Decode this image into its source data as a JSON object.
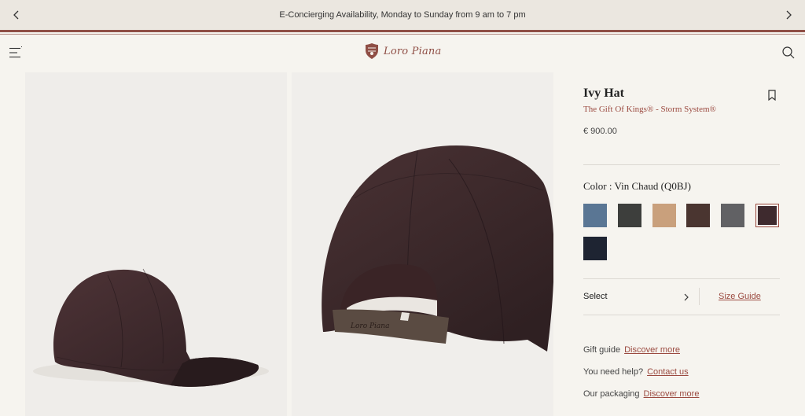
{
  "promo": {
    "text": "E-Concierging Availability, Monday to Sunday from 9 am to 7 pm"
  },
  "header": {
    "logo_text": "Loro Piana"
  },
  "colors": {
    "brand": "#8f4e45",
    "accent_text": "#9b4a40",
    "background": "#f6f4ef",
    "promo_bg": "#ebe7e0"
  },
  "product": {
    "title": "Ivy Hat",
    "subtitle": "The Gift Of Kings® - Storm System®",
    "price": "€ 900.00",
    "color_label": "Color : Vin Chaud (Q0BJ)",
    "swatches": [
      {
        "color": "#5a7694"
      },
      {
        "color": "#3d3e3c"
      },
      {
        "color": "#c9a07c"
      },
      {
        "color": "#4a3530"
      },
      {
        "color": "#616164"
      },
      {
        "color": "#3e2a2e",
        "selected": true
      },
      {
        "color": "#1e2432"
      }
    ],
    "select_label": "Select",
    "size_guide": "Size Guide"
  },
  "help_links": [
    {
      "label": "Gift guide",
      "link": "Discover more"
    },
    {
      "label": "You need help?",
      "link": "Contact us"
    },
    {
      "label": "Our packaging",
      "link": "Discover more"
    }
  ],
  "icons": [
    "chevron-left-icon",
    "chevron-right-icon",
    "menu-icon",
    "search-icon",
    "bookmark-icon",
    "chevron-right-icon"
  ]
}
